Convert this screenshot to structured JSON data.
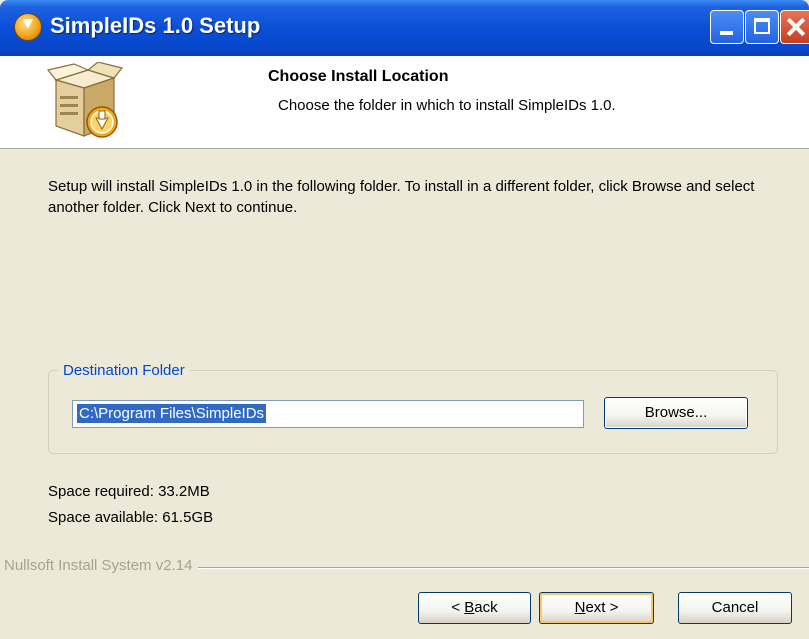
{
  "window": {
    "title": "SimpleIDs 1.0 Setup"
  },
  "header": {
    "title": "Choose Install Location",
    "subtitle": "Choose the folder in which to install SimpleIDs 1.0."
  },
  "body": {
    "description": "Setup will install SimpleIDs 1.0 in the following folder. To install in a different folder, click Browse and select another folder. Click Next to continue."
  },
  "destination": {
    "legend": "Destination Folder",
    "path": "C:\\Program Files\\SimpleIDs",
    "browse_label": "Browse..."
  },
  "space": {
    "required": "Space required: 33.2MB",
    "available": "Space available: 61.5GB"
  },
  "footer": {
    "branding": "Nullsoft Install System v2.14",
    "back_prefix": "< ",
    "back_key": "B",
    "back_rest": "ack",
    "next_key": "N",
    "next_rest": "ext >",
    "cancel_label": "Cancel"
  },
  "colors": {
    "titlebar": "#0a4fd8",
    "legend": "#0046d5",
    "selection": "#316ac5",
    "dialog": "#ece9d8"
  },
  "icons": {
    "window": "installer-icon",
    "header": "software-box-icon"
  }
}
